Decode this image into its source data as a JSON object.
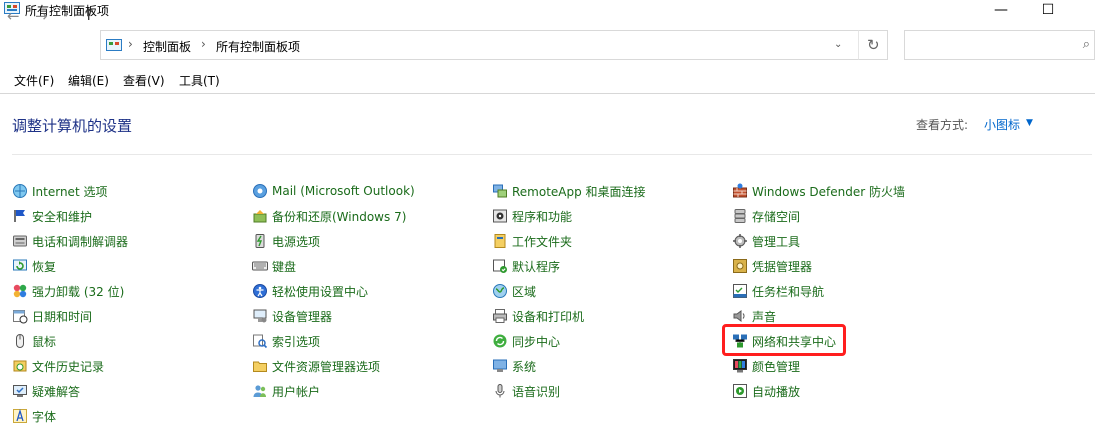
{
  "window": {
    "title": "所有控制面板项",
    "minimize_glyph": "—",
    "maximize_glyph": "☐"
  },
  "address": {
    "crumbs": [
      "控制面板",
      "所有控制面板项"
    ],
    "search_placeholder": ""
  },
  "menu": [
    "文件(F)",
    "编辑(E)",
    "查看(V)",
    "工具(T)"
  ],
  "header": {
    "title": "调整计算机的设置",
    "viewby_label": "查看方式:",
    "viewby_value": "小图标"
  },
  "columns": [
    {
      "items": [
        {
          "label": "Internet 选项",
          "icon": "internet-options-icon"
        },
        {
          "label": "安全和维护",
          "icon": "flag-icon"
        },
        {
          "label": "电话和调制解调器",
          "icon": "phone-modem-icon"
        },
        {
          "label": "恢复",
          "icon": "recovery-icon"
        },
        {
          "label": "强力卸载 (32 位)",
          "icon": "uninstall-icon"
        },
        {
          "label": "日期和时间",
          "icon": "date-time-icon"
        },
        {
          "label": "鼠标",
          "icon": "mouse-icon"
        },
        {
          "label": "文件历史记录",
          "icon": "file-history-icon"
        },
        {
          "label": "疑难解答",
          "icon": "troubleshoot-icon"
        },
        {
          "label": "字体",
          "icon": "font-icon"
        }
      ]
    },
    {
      "items": [
        {
          "label": "Mail (Microsoft Outlook)",
          "icon": "mail-icon"
        },
        {
          "label": "备份和还原(Windows 7)",
          "icon": "backup-icon"
        },
        {
          "label": "电源选项",
          "icon": "power-icon"
        },
        {
          "label": "键盘",
          "icon": "keyboard-icon"
        },
        {
          "label": "轻松使用设置中心",
          "icon": "ease-of-access-icon"
        },
        {
          "label": "设备管理器",
          "icon": "device-manager-icon"
        },
        {
          "label": "索引选项",
          "icon": "indexing-icon"
        },
        {
          "label": "文件资源管理器选项",
          "icon": "folder-options-icon"
        },
        {
          "label": "用户帐户",
          "icon": "user-accounts-icon"
        }
      ]
    },
    {
      "items": [
        {
          "label": "RemoteApp 和桌面连接",
          "icon": "remoteapp-icon"
        },
        {
          "label": "程序和功能",
          "icon": "programs-icon"
        },
        {
          "label": "工作文件夹",
          "icon": "work-folders-icon"
        },
        {
          "label": "默认程序",
          "icon": "default-programs-icon"
        },
        {
          "label": "区域",
          "icon": "region-icon"
        },
        {
          "label": "设备和打印机",
          "icon": "printer-icon"
        },
        {
          "label": "同步中心",
          "icon": "sync-icon"
        },
        {
          "label": "系统",
          "icon": "system-icon"
        },
        {
          "label": "语音识别",
          "icon": "microphone-icon"
        }
      ]
    },
    {
      "items": [
        {
          "label": "Windows Defender 防火墙",
          "icon": "firewall-icon"
        },
        {
          "label": "存储空间",
          "icon": "storage-icon"
        },
        {
          "label": "管理工具",
          "icon": "admin-tools-icon"
        },
        {
          "label": "凭据管理器",
          "icon": "credential-icon"
        },
        {
          "label": "任务栏和导航",
          "icon": "taskbar-icon"
        },
        {
          "label": "声音",
          "icon": "sound-icon"
        },
        {
          "label": "网络和共享中心",
          "icon": "network-icon"
        },
        {
          "label": "颜色管理",
          "icon": "color-management-icon"
        },
        {
          "label": "自动播放",
          "icon": "autoplay-icon"
        }
      ]
    }
  ],
  "highlighted_item": "网络和共享中心",
  "colors": {
    "link": "#1a6b1a",
    "heading": "#1e3287",
    "accent": "#0066cc",
    "highlight": "#ff1e1e"
  }
}
